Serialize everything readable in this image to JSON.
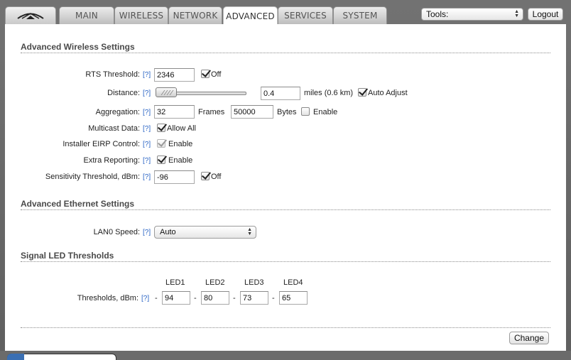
{
  "tabs": [
    {
      "label": "MAIN",
      "active": false
    },
    {
      "label": "WIRELESS",
      "active": false
    },
    {
      "label": "NETWORK",
      "active": false
    },
    {
      "label": "ADVANCED",
      "active": true
    },
    {
      "label": "SERVICES",
      "active": false
    },
    {
      "label": "SYSTEM",
      "active": false
    }
  ],
  "header": {
    "tools_label": "Tools:",
    "logout_label": "Logout"
  },
  "help_label": "[?]",
  "wireless": {
    "title": "Advanced Wireless Settings",
    "rts": {
      "label": "RTS Threshold:",
      "value": "2346",
      "off_label": "Off",
      "off_checked": true
    },
    "distance": {
      "label": "Distance:",
      "value": "0.4",
      "unit_text": "miles (0.6 km)",
      "auto_label": "Auto Adjust",
      "auto_checked": true
    },
    "aggregation": {
      "label": "Aggregation:",
      "frames_value": "32",
      "frames_label": "Frames",
      "bytes_value": "50000",
      "bytes_label": "Bytes",
      "enable_label": "Enable",
      "enable_checked": false
    },
    "multicast": {
      "label": "Multicast Data:",
      "allow_label": "Allow All",
      "checked": true
    },
    "installer_eirp": {
      "label": "Installer EIRP Control:",
      "enable_label": "Enable",
      "checked": true,
      "disabled": true
    },
    "extra_reporting": {
      "label": "Extra Reporting:",
      "enable_label": "Enable",
      "checked": true
    },
    "sensitivity": {
      "label": "Sensitivity Threshold, dBm:",
      "value": "-96",
      "off_label": "Off",
      "off_checked": true
    }
  },
  "ethernet": {
    "title": "Advanced Ethernet Settings",
    "lan0": {
      "label": "LAN0 Speed:",
      "value": "Auto"
    }
  },
  "led": {
    "title": "Signal LED Thresholds",
    "headers": [
      "LED1",
      "LED2",
      "LED3",
      "LED4"
    ],
    "label": "Thresholds, dBm:",
    "separator": "-",
    "values": [
      "94",
      "80",
      "73",
      "65"
    ]
  },
  "change_label": "Change",
  "colors": {
    "help_link": "#2a64c5",
    "section_title": "#4a4a4a"
  }
}
